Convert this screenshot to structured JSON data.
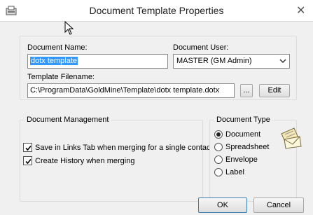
{
  "window": {
    "title": "Document Template Properties"
  },
  "document_name": {
    "label": "Document Name:",
    "value": "dotx template"
  },
  "document_user": {
    "label": "Document User:",
    "selected": "MASTER (GM Admin)"
  },
  "template_filename": {
    "label": "Template Filename:",
    "value": "C:\\ProgramData\\GoldMine\\Template\\dotx template.dotx",
    "browse_label": "...",
    "edit_label": "Edit"
  },
  "document_management": {
    "title": "Document Management",
    "options": [
      {
        "label": "Save in Links Tab when merging for a single contact",
        "checked": true
      },
      {
        "label": "Create History when merging",
        "checked": true
      }
    ]
  },
  "document_type": {
    "title": "Document Type",
    "options": [
      {
        "label": "Document",
        "selected": true
      },
      {
        "label": "Spreadsheet",
        "selected": false
      },
      {
        "label": "Envelope",
        "selected": false
      },
      {
        "label": "Label",
        "selected": false
      }
    ],
    "icon": "letter-envelope-icon"
  },
  "buttons": {
    "ok_label": "OK",
    "cancel_label": "Cancel"
  },
  "colors": {
    "selection": "#3399ff",
    "dialog_bg": "#f0f0f0"
  }
}
